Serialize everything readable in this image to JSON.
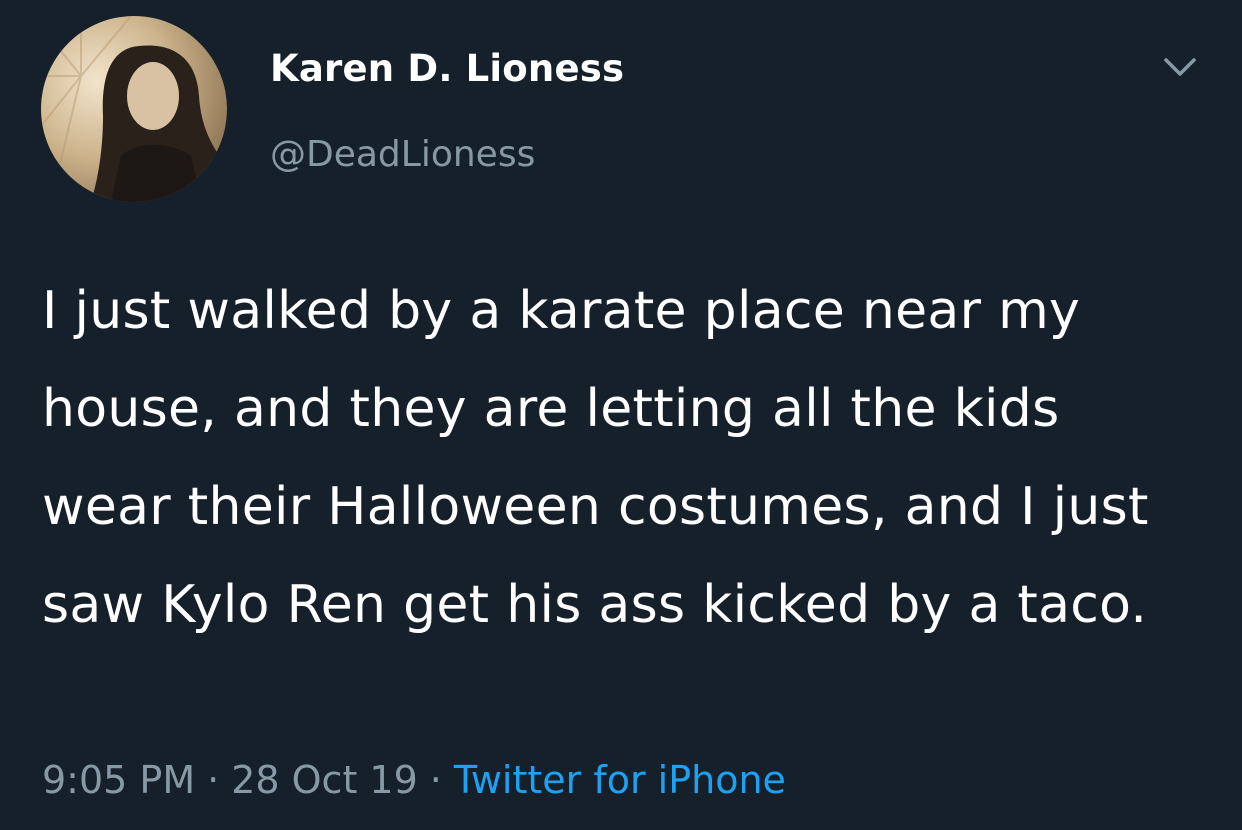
{
  "tweet": {
    "author": {
      "display_name": "Karen D. Lioness",
      "handle": "@DeadLioness",
      "avatar_icon": "profile-photo"
    },
    "menu_icon": "chevron-down-icon",
    "text": "I just walked by a karate place near my house, and they are letting all the kids wear their Halloween costumes, and I just saw Kylo Ren get his ass kicked by a taco.",
    "time": "9:05 PM",
    "date": "28 Oct 19",
    "separator": "·",
    "source": "Twitter for iPhone"
  },
  "colors": {
    "background": "#15202b",
    "primary_text": "#ffffff",
    "secondary_text": "#8899a6",
    "link": "#1da1f2"
  }
}
